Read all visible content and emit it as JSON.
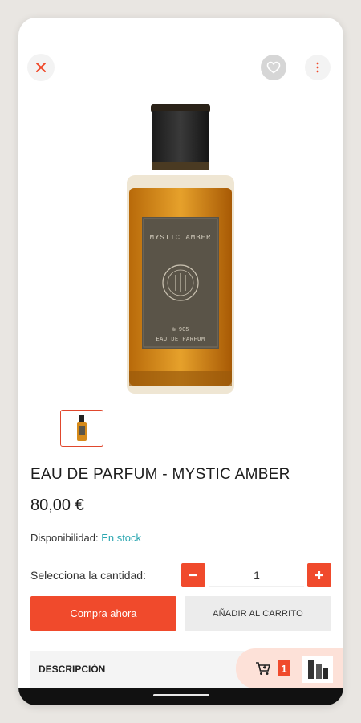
{
  "product": {
    "title": "EAU DE PARFUM - MYSTIC AMBER",
    "price": "80,00 €",
    "availability_label": "Disponibilidad:",
    "availability_value": "En stock",
    "bottle_label_name": "MYSTIC AMBER",
    "bottle_label_number": "№ 905",
    "bottle_label_type": "EAU DE PARFUM"
  },
  "quantity": {
    "label": "Selecciona la cantidad:",
    "value": "1"
  },
  "actions": {
    "buy_now": "Compra ahora",
    "add_to_cart": "AÑADIR AL CARRITO"
  },
  "description": {
    "label": "DESCRIPCIÓN"
  },
  "cart": {
    "count": "1"
  },
  "icons": {
    "close": "close-icon",
    "favorite": "heart-icon",
    "menu": "more-vertical-icon",
    "cart": "cart-icon",
    "minus": "minus-icon",
    "plus": "plus-icon"
  },
  "colors": {
    "accent": "#f04a2c",
    "stock": "#2aa6b0",
    "cart_float_bg": "#fde1d8"
  }
}
